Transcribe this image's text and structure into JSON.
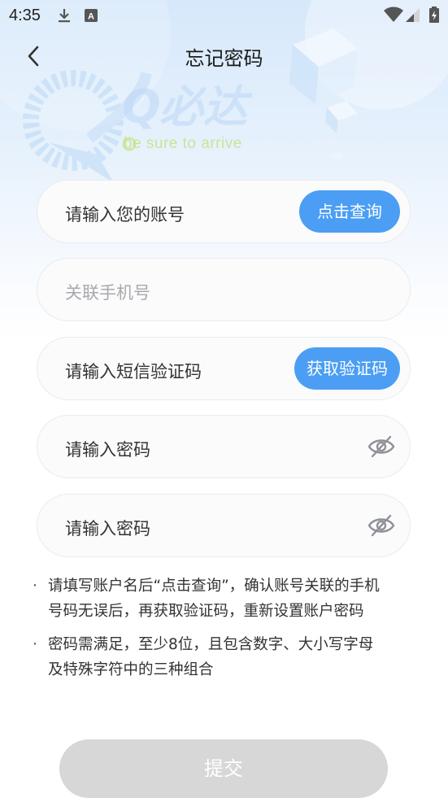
{
  "status_bar": {
    "time": "4:35",
    "icons": [
      "download-icon",
      "keyboard-a-icon",
      "wifi-icon",
      "signal-icon",
      "battery-icon"
    ],
    "keyboard_letter": "A"
  },
  "header": {
    "title": "忘记密码",
    "back_icon": "chevron-left-icon"
  },
  "brand": {
    "logo_text": "Q必达",
    "slogan": "be sure to arrive"
  },
  "form": {
    "account": {
      "placeholder": "请输入您的账号",
      "button_label": "点击查询"
    },
    "phone": {
      "placeholder": "关联手机号"
    },
    "sms_code": {
      "placeholder": "请输入短信验证码",
      "button_label": "获取验证码"
    },
    "password": {
      "placeholder": "请输入密码",
      "toggle_icon": "eye-off-icon"
    },
    "password_confirm": {
      "placeholder": "请输入密码",
      "toggle_icon": "eye-off-icon"
    }
  },
  "notes": [
    {
      "bullet": "·",
      "line1": "请填写账户名后“点击查询”，确认账号关联的手机",
      "line2": "号码无误后，再获取验证码，重新设置账户密码"
    },
    {
      "bullet": "·",
      "line1": "密码需满足，至少8位，且包含数字、大小写字母",
      "line2": "及特殊字符中的三种组合"
    }
  ],
  "submit": {
    "label": "提交",
    "enabled": false
  },
  "colors": {
    "accent": "#4b9ef3",
    "disabled": "#d7d7d8",
    "bg_top": "#d6e8fb"
  }
}
